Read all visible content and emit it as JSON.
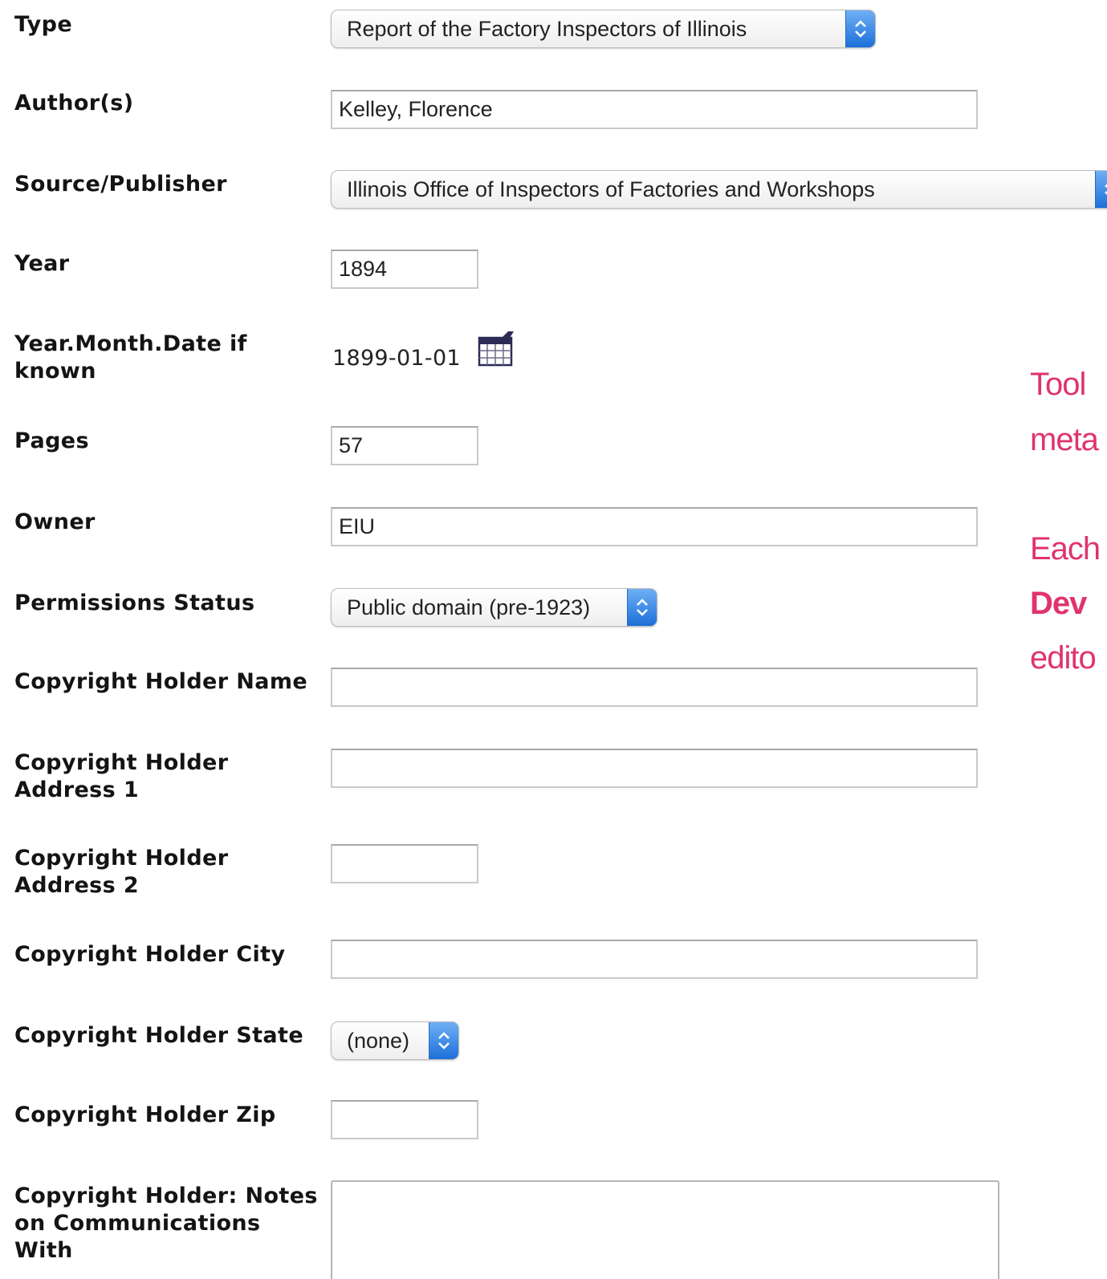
{
  "form": {
    "type": {
      "label": "Type",
      "value": "Report of the Factory Inspectors of Illinois"
    },
    "authors": {
      "label": "Author(s)",
      "value": "Kelley, Florence"
    },
    "source": {
      "label": "Source/Publisher",
      "value": "Illinois Office of Inspectors of Factories and Workshops"
    },
    "year": {
      "label": "Year",
      "value": "1894"
    },
    "date": {
      "label_line1": "Year.Month.Date if",
      "label_line2": "known",
      "value": "1899-01-01"
    },
    "pages": {
      "label": "Pages",
      "value": "57"
    },
    "owner": {
      "label": "Owner",
      "value": "EIU"
    },
    "permissions": {
      "label": "Permissions Status",
      "value": "Public domain (pre-1923)"
    },
    "ch_name": {
      "label": "Copyright Holder Name",
      "value": ""
    },
    "ch_addr1": {
      "label_line1": "Copyright Holder",
      "label_line2": "Address 1",
      "value": ""
    },
    "ch_addr2": {
      "label_line1": "Copyright Holder",
      "label_line2": "Address 2",
      "value": ""
    },
    "ch_city": {
      "label": "Copyright Holder City",
      "value": ""
    },
    "ch_state": {
      "label": "Copyright Holder State",
      "value": "(none)"
    },
    "ch_zip": {
      "label": "Copyright Holder Zip",
      "value": ""
    },
    "ch_notes": {
      "label_line1": "Copyright Holder: Notes",
      "label_line2": "on Communications",
      "label_line3": "With",
      "value": ""
    }
  },
  "side_note": {
    "line1": "Tool",
    "line2": "meta",
    "line3": "Each",
    "line4": "Dev",
    "line5": "edito"
  },
  "colors": {
    "accent_pink": "#e0336f",
    "select_button_blue": "#2a7be4"
  }
}
